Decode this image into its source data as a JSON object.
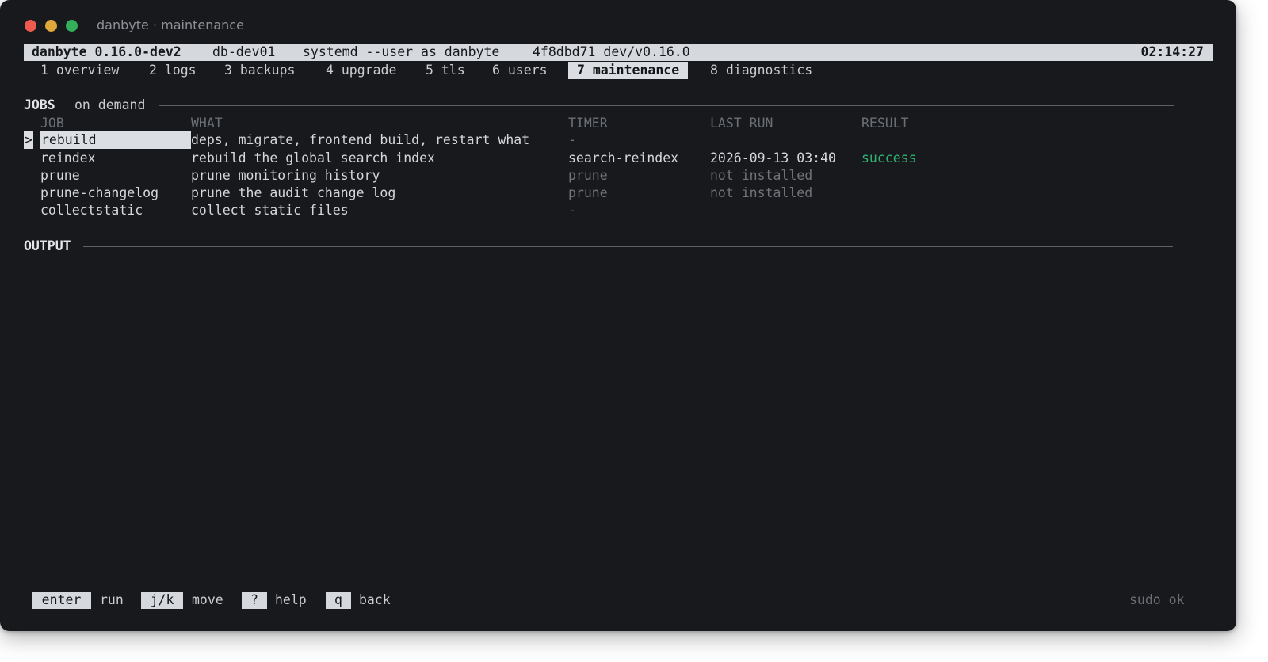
{
  "window": {
    "title": "danbyte · maintenance"
  },
  "statusbar": {
    "app": "danbyte 0.16.0-dev2",
    "host": "db-dev01",
    "mode": "systemd --user as danbyte",
    "commit": "4f8dbd71 dev/v0.16.0",
    "clock": "02:14:27"
  },
  "tabs": [
    {
      "label": "1 overview"
    },
    {
      "label": "2 logs"
    },
    {
      "label": "3 backups"
    },
    {
      "label": "4 upgrade"
    },
    {
      "label": "5 tls"
    },
    {
      "label": "6 users"
    },
    {
      "label": "7 maintenance",
      "active": true
    },
    {
      "label": "8 diagnostics"
    }
  ],
  "jobs": {
    "title": "JOBS",
    "subtitle": "on demand",
    "cursor": ">",
    "columns": {
      "job": "JOB",
      "what": "WHAT",
      "timer": "TIMER",
      "last_run": "LAST RUN",
      "result": "RESULT"
    },
    "rows": [
      {
        "job": "rebuild",
        "what": "deps, migrate, frontend build, restart what",
        "timer": "-",
        "last_run": "",
        "result": "",
        "selected": true
      },
      {
        "job": "reindex",
        "what": "rebuild the global search index",
        "timer": "search-reindex",
        "last_run": "2026-09-13 03:40",
        "result": "success"
      },
      {
        "job": "prune",
        "what": "prune monitoring history",
        "timer": "prune",
        "last_run": "not installed",
        "result": ""
      },
      {
        "job": "prune-changelog",
        "what": "prune the audit change log",
        "timer": "prune",
        "last_run": "not installed",
        "result": ""
      },
      {
        "job": "collectstatic",
        "what": "collect static files",
        "timer": "-",
        "last_run": "",
        "result": ""
      }
    ]
  },
  "output": {
    "title": "OUTPUT"
  },
  "footer": {
    "keys": [
      {
        "key": "enter",
        "label": "run"
      },
      {
        "key": "j/k",
        "label": "move"
      },
      {
        "key": "?",
        "label": "help"
      },
      {
        "key": "q",
        "label": "back"
      }
    ],
    "status": "sudo ok"
  },
  "colors": {
    "background": "#17191d",
    "highlight": "#dbdfe3",
    "success": "#33b372",
    "muted": "#6f747b"
  }
}
